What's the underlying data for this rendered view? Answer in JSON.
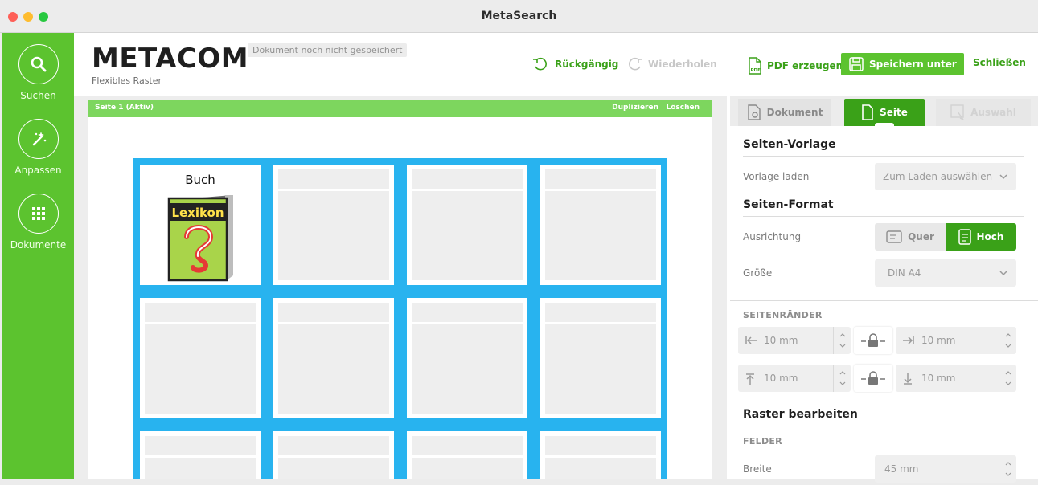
{
  "window": {
    "title": "MetaSearch"
  },
  "sidebar": {
    "items": [
      {
        "label": "Suchen",
        "icon": "search-icon"
      },
      {
        "label": "Anpassen",
        "icon": "magic-wand-icon"
      },
      {
        "label": "Dokumente",
        "icon": "grid-icon"
      }
    ]
  },
  "header": {
    "brand": "METACOM",
    "status": "Dokument noch nicht gespeichert",
    "subtitle": "Flexibles Raster"
  },
  "toolbar": {
    "undo": "Rückgängig",
    "redo": "Wiederholen",
    "pdf": "PDF erzeugen",
    "save_as": "Speichern unter",
    "close": "Schließen"
  },
  "page": {
    "label": "Seite 1 (Aktiv)",
    "duplicate": "Duplizieren",
    "delete": "Löschen"
  },
  "grid": {
    "cells": [
      {
        "title": "Buch",
        "symbol_label": "Lexikon"
      }
    ]
  },
  "panel": {
    "tabs": {
      "document": "Dokument",
      "page": "Seite",
      "selection": "Auswahl"
    },
    "template": {
      "title": "Seiten-Vorlage",
      "load_label": "Vorlage laden",
      "load_value": "Zum Laden auswählen"
    },
    "format": {
      "title": "Seiten-Format",
      "orientation_label": "Ausrichtung",
      "landscape": "Quer",
      "portrait": "Hoch",
      "size_label": "Größe",
      "size_value": "DIN A4"
    },
    "margins": {
      "title": "SEITENRÄNDER",
      "left": "10 mm",
      "right": "10 mm",
      "top": "10 mm",
      "bottom": "10 mm"
    },
    "raster": {
      "title": "Raster bearbeiten",
      "fields_caption": "FELDER",
      "width_label": "Breite",
      "width_value": "45 mm"
    }
  },
  "colors": {
    "brand_green": "#5cc32f",
    "accent_green": "#3aa118",
    "grid_blue": "#28b3ef"
  }
}
